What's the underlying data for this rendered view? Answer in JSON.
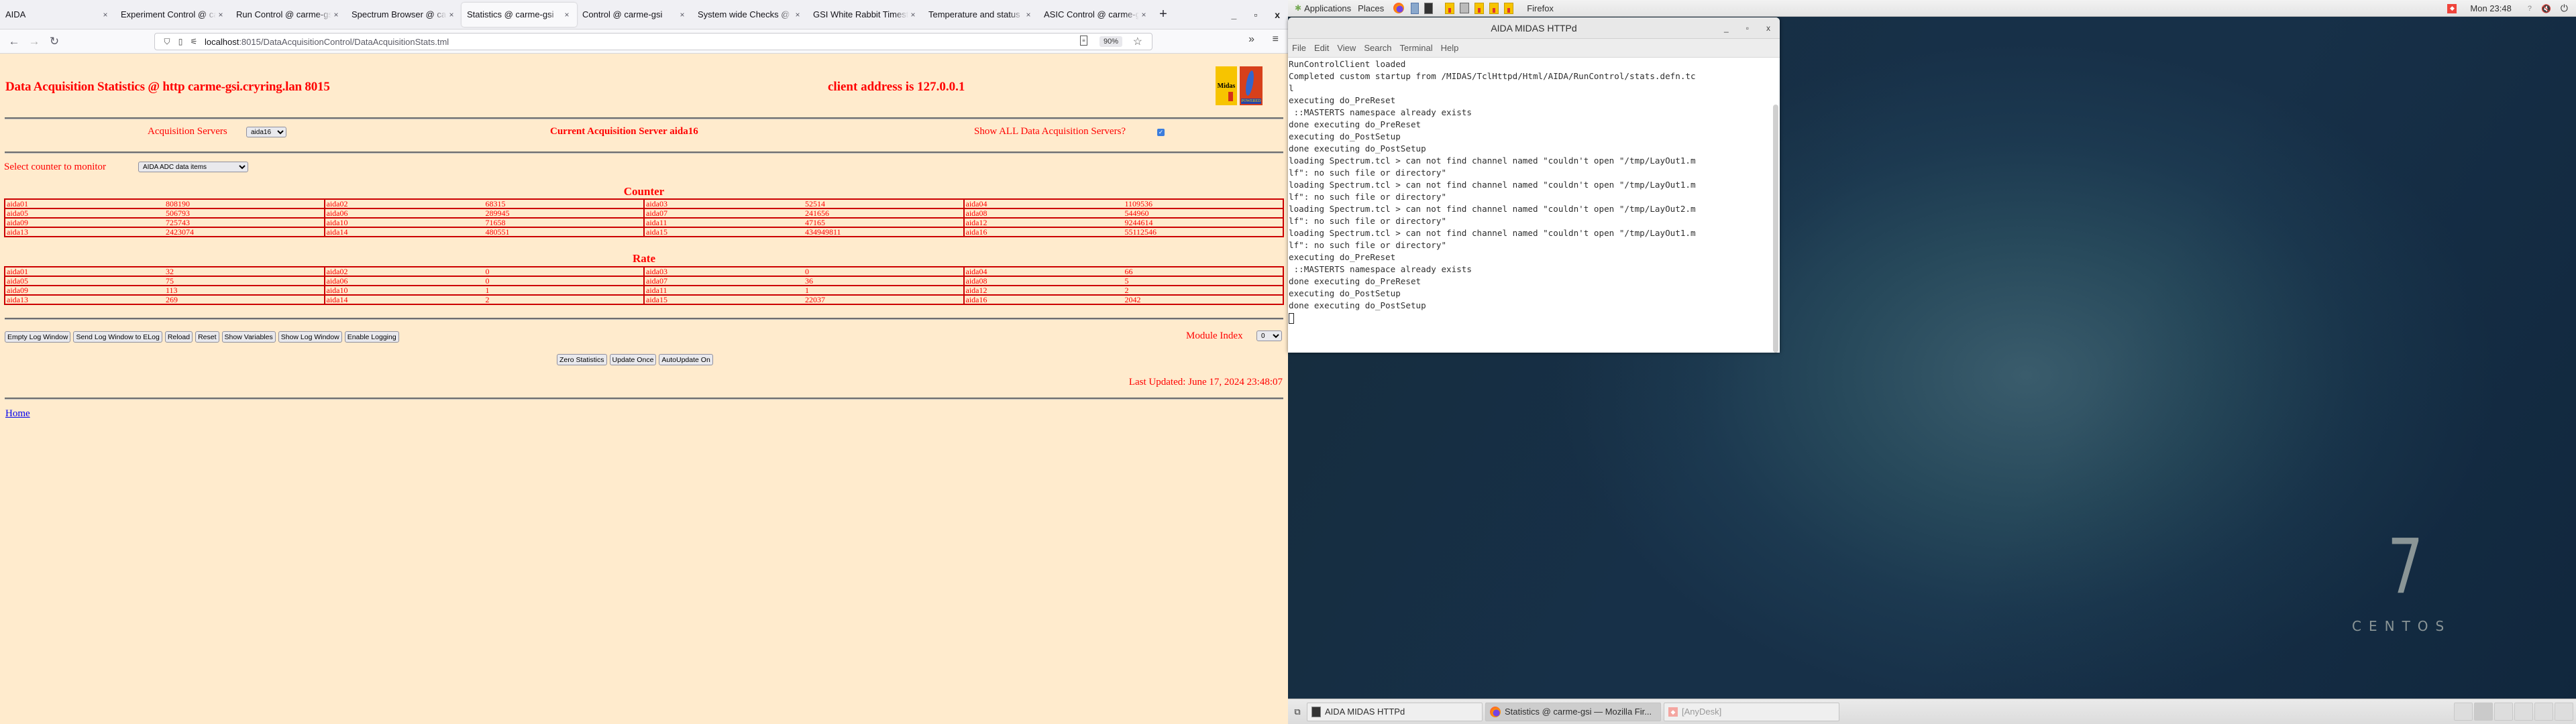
{
  "browser": {
    "tabs": [
      {
        "label": "AIDA",
        "active": false
      },
      {
        "label": "Experiment Control @ carme-gsi",
        "active": false
      },
      {
        "label": "Run Control @ carme-gsi",
        "active": false
      },
      {
        "label": "Spectrum Browser @ carme-gsi",
        "active": false
      },
      {
        "label": "Statistics @ carme-gsi",
        "active": true
      },
      {
        "label": "Control @ carme-gsi",
        "active": false
      },
      {
        "label": "System wide Checks @ carme-gsi",
        "active": false
      },
      {
        "label": "GSI White Rabbit Timestamp",
        "active": false
      },
      {
        "label": "Temperature and status",
        "active": false
      },
      {
        "label": "ASIC Control @ carme-gsi",
        "active": false
      }
    ],
    "tab_close": "×",
    "new_tab": "+",
    "window_controls": {
      "minimize": "_",
      "maximize": "▫",
      "close": "x"
    },
    "nav": {
      "back": "←",
      "forward": "→",
      "reload": "↻"
    },
    "url": {
      "host": "localhost",
      "path": ":8015/DataAcquisitionControl/DataAcquisitionStats.tml"
    },
    "zoom_level": "90%",
    "bookmark_star": "☆",
    "overflow": "»",
    "menu": "≡"
  },
  "page": {
    "title": "Data Acquisition Statistics @ http carme-gsi.cryring.lan 8015",
    "client_address": "client address is 127.0.0.1",
    "logos": {
      "midas": "Midas",
      "tcl": "POWERED"
    },
    "acquisition_servers_label": "Acquisition Servers",
    "acquisition_server_selected": "aida16",
    "current_server": "Current Acquisition Server aida16",
    "show_all_label": "Show ALL Data Acquisition Servers?",
    "show_all_checked": true,
    "counter_label": "Select counter to monitor",
    "counter_selected": "AIDA ADC data items",
    "counter_section_title": "Counter",
    "rate_section_title": "Rate",
    "counter_rows": [
      [
        [
          "aida01",
          "808190"
        ],
        [
          "aida02",
          "68315"
        ],
        [
          "aida03",
          "52514"
        ],
        [
          "aida04",
          "1109536"
        ]
      ],
      [
        [
          "aida05",
          "506793"
        ],
        [
          "aida06",
          "289945"
        ],
        [
          "aida07",
          "241656"
        ],
        [
          "aida08",
          "544960"
        ]
      ],
      [
        [
          "aida09",
          "725743"
        ],
        [
          "aida10",
          "71658"
        ],
        [
          "aida11",
          "47165"
        ],
        [
          "aida12",
          "9244614"
        ]
      ],
      [
        [
          "aida13",
          "2423074"
        ],
        [
          "aida14",
          "480551"
        ],
        [
          "aida15",
          "434949811"
        ],
        [
          "aida16",
          "55112546"
        ]
      ]
    ],
    "rate_rows": [
      [
        [
          "aida01",
          "32"
        ],
        [
          "aida02",
          "0"
        ],
        [
          "aida03",
          "0"
        ],
        [
          "aida04",
          "66"
        ]
      ],
      [
        [
          "aida05",
          "75"
        ],
        [
          "aida06",
          "0"
        ],
        [
          "aida07",
          "36"
        ],
        [
          "aida08",
          "5"
        ]
      ],
      [
        [
          "aida09",
          "113"
        ],
        [
          "aida10",
          "1"
        ],
        [
          "aida11",
          "1"
        ],
        [
          "aida12",
          "2"
        ]
      ],
      [
        [
          "aida13",
          "269"
        ],
        [
          "aida14",
          "2"
        ],
        [
          "aida15",
          "22037"
        ],
        [
          "aida16",
          "2042"
        ]
      ]
    ],
    "log_buttons": [
      "Empty Log Window",
      "Send Log Window to ELog",
      "Reload",
      "Reset",
      "Show Variables",
      "Show Log Window",
      "Enable Logging"
    ],
    "module_index_label": "Module Index",
    "module_index_selected": "0",
    "stats_buttons": [
      "Zero Statistics",
      "Update Once",
      "AutoUpdate On"
    ],
    "last_updated": "Last Updated: June 17, 2024 23:48:07",
    "home_link": "Home"
  },
  "desktop": {
    "topbar": {
      "applications": "Applications",
      "places": "Places",
      "active_app": "Firefox",
      "clock": "Mon 23:48"
    },
    "terminal": {
      "title": "AIDA MIDAS HTTPd",
      "menu": [
        "File",
        "Edit",
        "View",
        "Search",
        "Terminal",
        "Help"
      ],
      "lines": [
        "RunControlClient loaded",
        "Completed custom startup from /MIDAS/TclHttpd/Html/AIDA/RunControl/stats.defn.tc",
        "l",
        "executing do_PreReset",
        " ::MASTERTS namespace already exists",
        "done executing do_PreReset",
        "executing do_PostSetup",
        "done executing do_PostSetup",
        "loading Spectrum.tcl > can not find channel named \"couldn't open \"/tmp/LayOut1.m",
        "lf\": no such file or directory\"",
        "loading Spectrum.tcl > can not find channel named \"couldn't open \"/tmp/LayOut1.m",
        "lf\": no such file or directory\"",
        "loading Spectrum.tcl > can not find channel named \"couldn't open \"/tmp/LayOut2.m",
        "lf\": no such file or directory\"",
        "loading Spectrum.tcl > can not find channel named \"couldn't open \"/tmp/LayOut1.m",
        "lf\": no such file or directory\"",
        "executing do_PreReset",
        " ::MASTERTS namespace already exists",
        "done executing do_PreReset",
        "executing do_PostSetup",
        "done executing do_PostSetup"
      ]
    },
    "centos": {
      "version": "7",
      "name": "CENTOS"
    },
    "taskbar": [
      {
        "label": "AIDA MIDAS HTTPd",
        "icon": "terminal-icon",
        "active": false
      },
      {
        "label": "Statistics @ carme-gsi — Mozilla Fir...",
        "icon": "firefox-icon",
        "active": true
      },
      {
        "label": "[AnyDesk]",
        "icon": "anydesk-icon",
        "active": false
      }
    ]
  }
}
